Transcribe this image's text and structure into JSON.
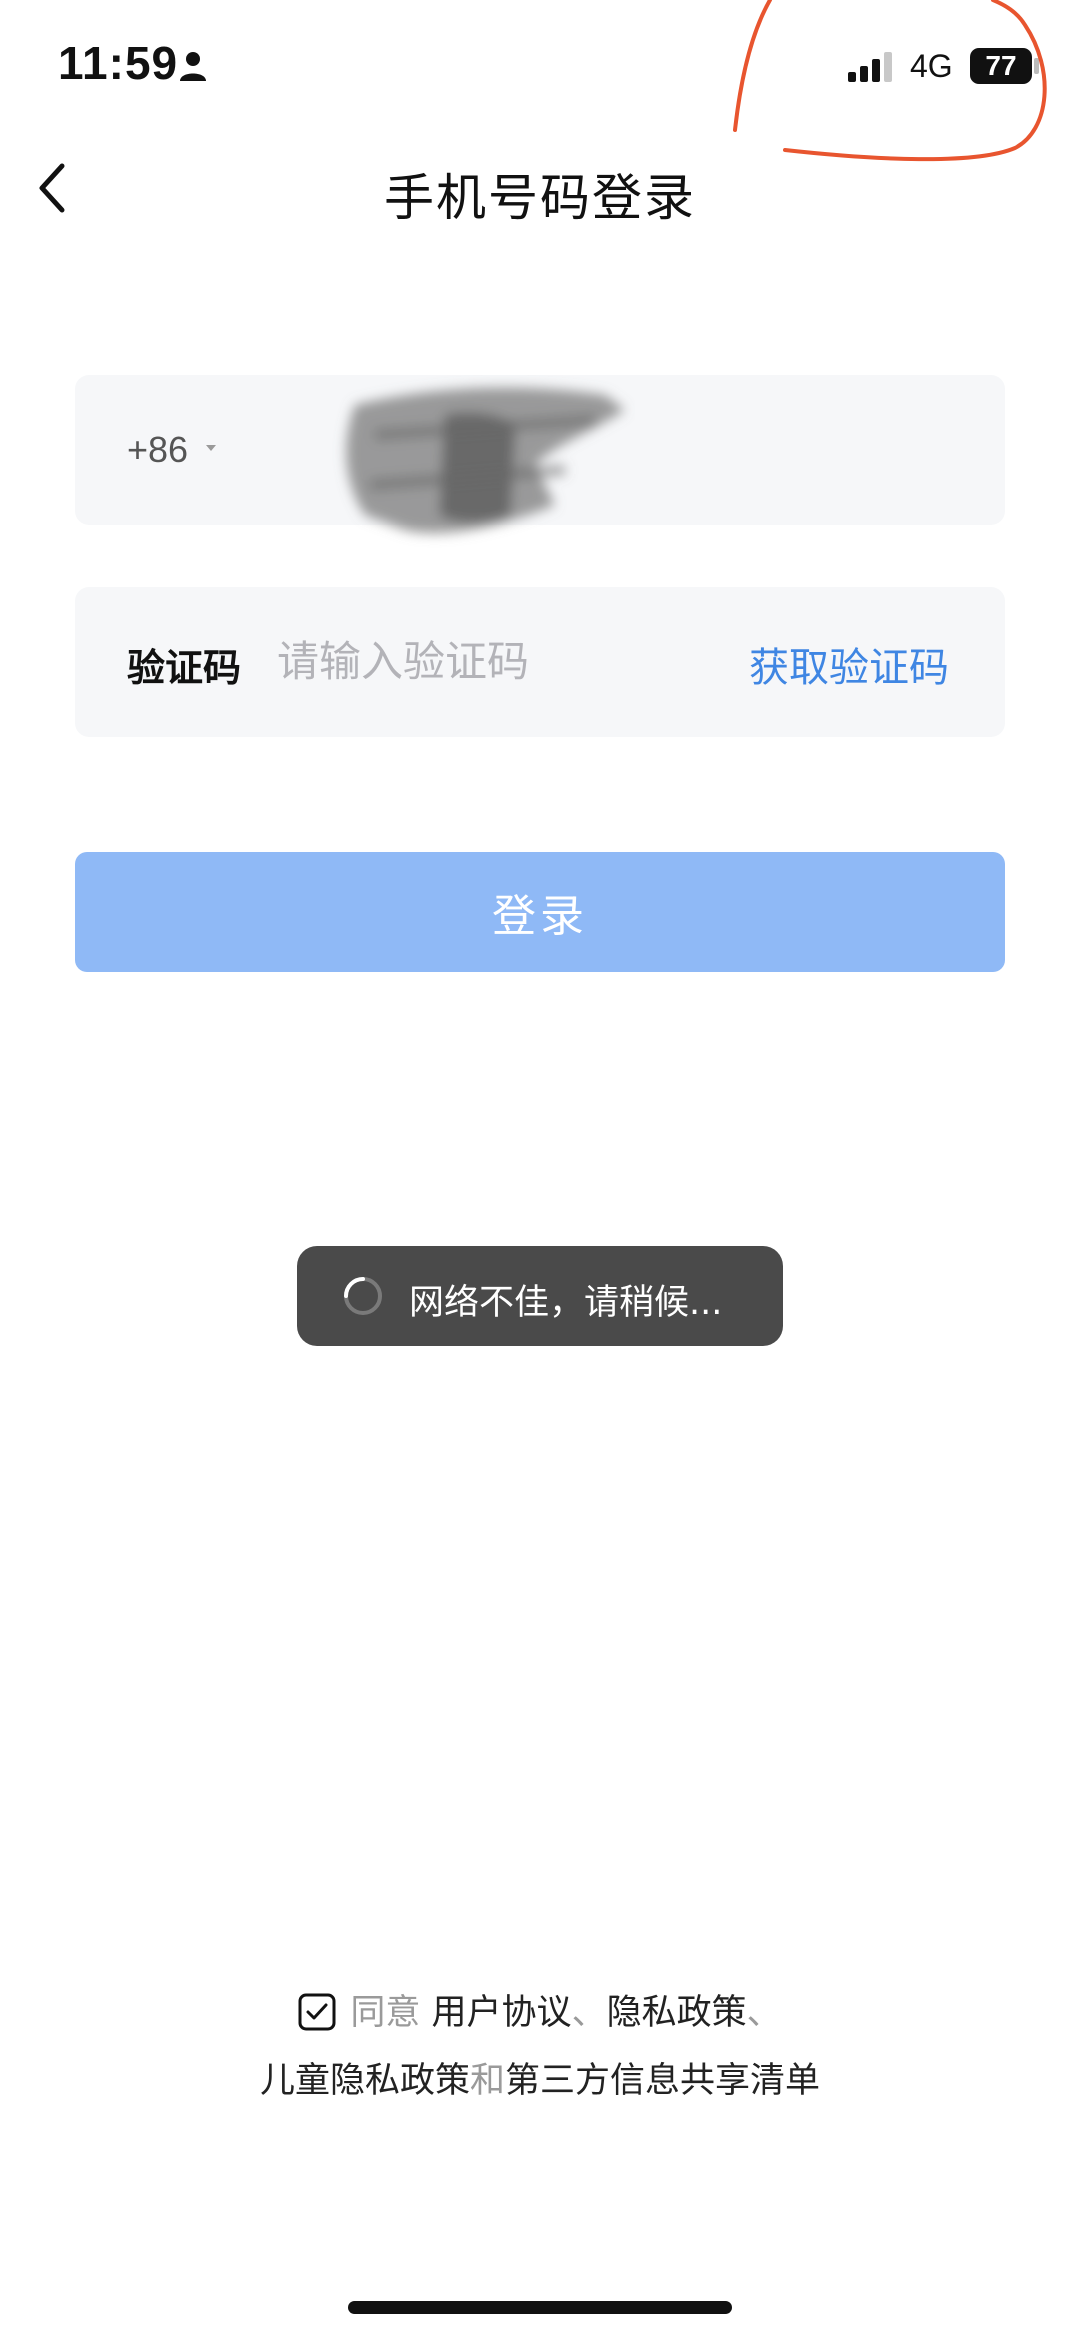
{
  "status_bar": {
    "time": "11:59",
    "network": "4G",
    "battery": "77",
    "person_icon": "person-icon",
    "signal_icon": "signal-bars-icon"
  },
  "nav": {
    "back_icon": "chevron-left-icon",
    "title": "手机号码登录"
  },
  "phone_field": {
    "country_code": "+86"
  },
  "code_field": {
    "label": "验证码",
    "placeholder": "请输入验证码",
    "value": "",
    "action": "获取验证码"
  },
  "login_button": {
    "label": "登录"
  },
  "toast": {
    "icon": "loading-spinner-icon",
    "message": "网络不佳，请稍候..."
  },
  "agreement": {
    "checked": true,
    "agree": "同意",
    "user_agreement": "用户协议",
    "separator": "、",
    "privacy_policy": "隐私政策",
    "children_privacy_policy": "儿童隐私政策",
    "and": "和",
    "third_party_list": "第三方信息共享清单"
  },
  "colors": {
    "accent": "#3f86e3",
    "login_button_disabled": "#8fb9f6",
    "field_background": "#f6f7f9",
    "toast_background": "#4a4a4a",
    "annotation": "#e8552f"
  }
}
